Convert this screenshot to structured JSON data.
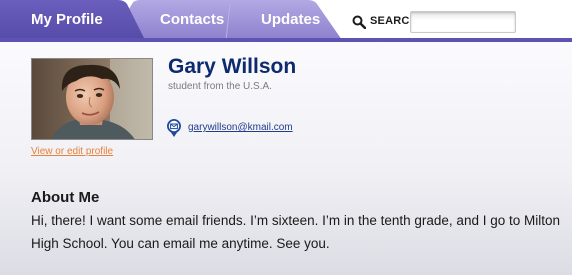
{
  "nav": {
    "tabs": [
      {
        "label": "My Profile",
        "active": true
      },
      {
        "label": "Contacts",
        "active": false
      },
      {
        "label": "Updates",
        "active": false
      }
    ],
    "search": {
      "label": "SEARCH",
      "icon": "search-icon",
      "value": ""
    }
  },
  "profile": {
    "name": "Gary Willson",
    "subtitle": "student from the U.S.A.",
    "email": "garywillson@kmail.com",
    "email_icon": "email-icon",
    "edit_link": "View or edit profile"
  },
  "about": {
    "heading": "About Me",
    "text": "Hi, there! I want some email friends. I’m sixteen. I’m in the tenth grade, and I go to Milton High School. You can email me anytime. See you."
  },
  "colors": {
    "nav_active": "#5e52b2",
    "nav_inactive": "#9a90d6",
    "accent_orange": "#e8813a",
    "name_blue": "#0e2a6e"
  }
}
